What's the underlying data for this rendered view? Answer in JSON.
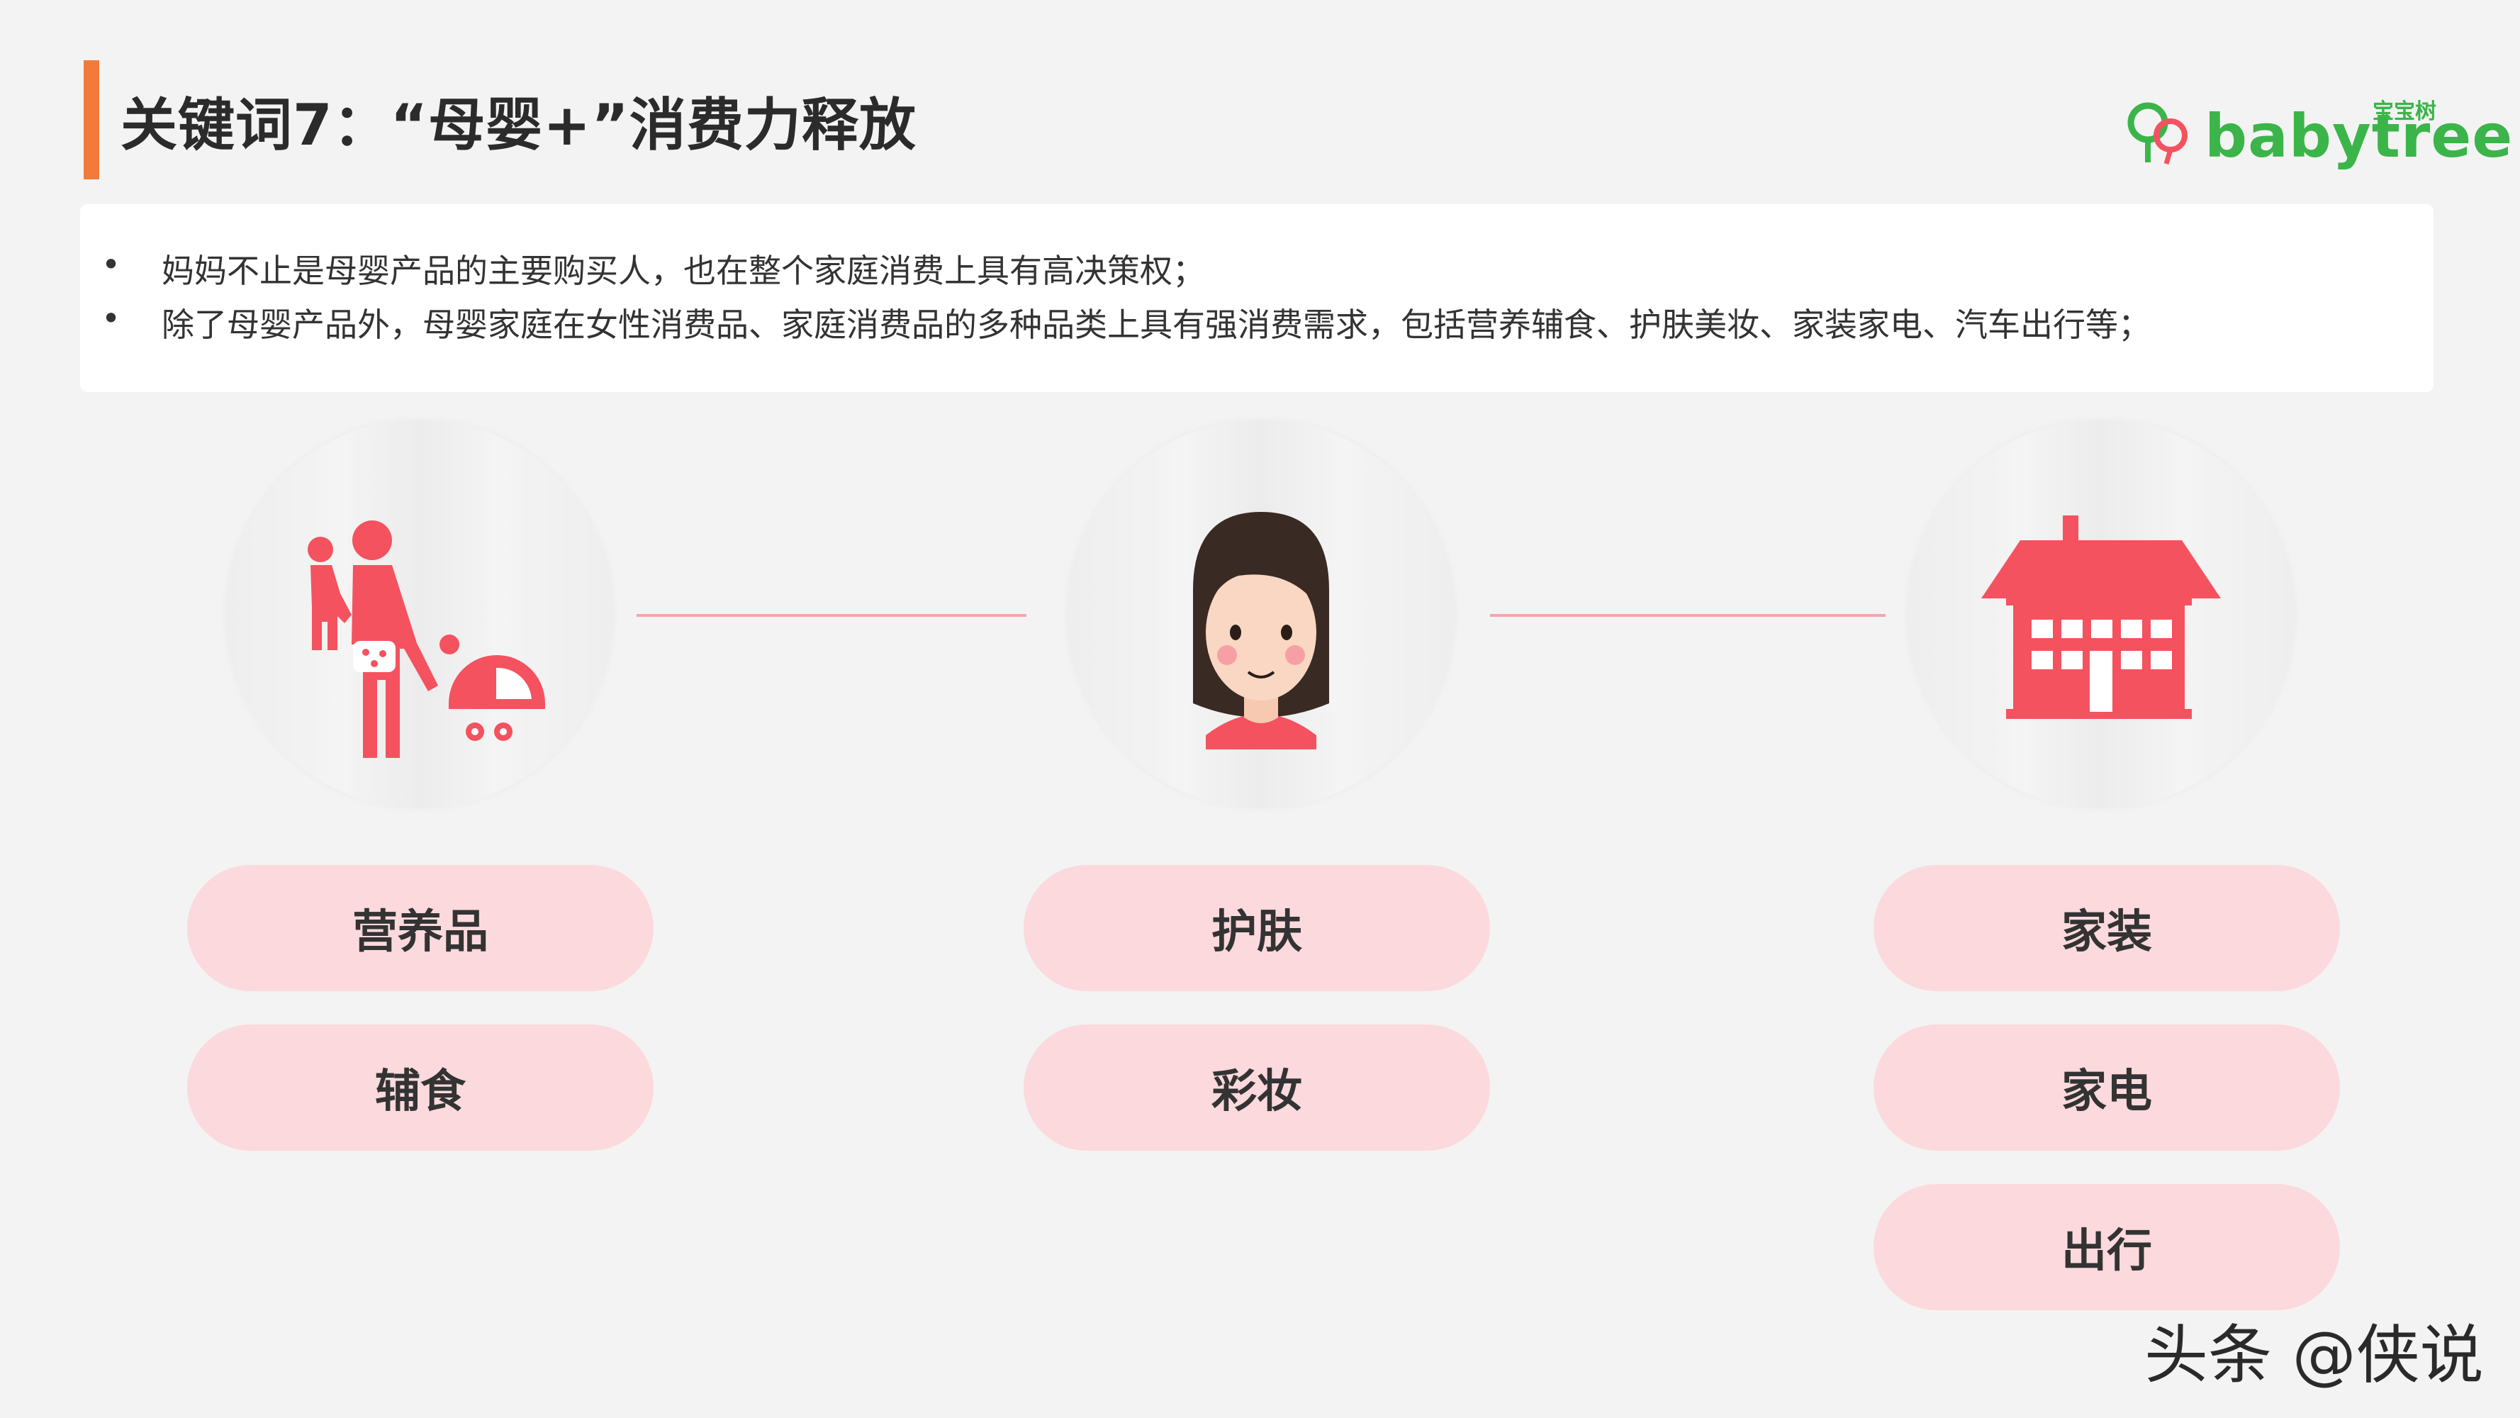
{
  "title": "关键词7：“母婴+”消费力释放",
  "logo": {
    "cn": "宝宝树",
    "en": "babytree"
  },
  "bullets": [
    "妈妈不止是母婴产品的主要购买人，也在整个家庭消费上具有高决策权；",
    "除了母婴产品外，母婴家庭在女性消费品、家庭消费品的多种品类上具有强消费需求，包括营养辅食、护肤美妆、家装家电、汽车出行等；"
  ],
  "bullet_symbol": "•",
  "icons": {
    "left": "mother-stroller-icon",
    "center": "woman-face-icon",
    "right": "house-icon"
  },
  "colors": {
    "accent": "#f27b3a",
    "icon": "#f4525f",
    "pill": "#fcd9dd",
    "connector": "#f4a5ad",
    "brand": "#3bb54a"
  },
  "columns": [
    {
      "tags": [
        "营养品",
        "辅食"
      ]
    },
    {
      "tags": [
        "护肤",
        "彩妆"
      ]
    },
    {
      "tags": [
        "家装",
        "家电",
        "出行"
      ]
    }
  ],
  "watermark": "头条 @侠说"
}
